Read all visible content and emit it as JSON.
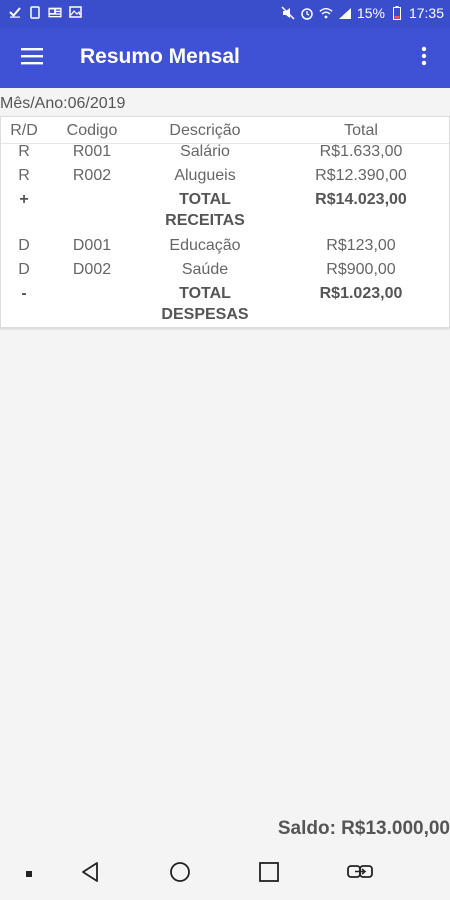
{
  "status_bar": {
    "icons_left": [
      "check-icon",
      "sim-icon",
      "news-icon",
      "image-icon"
    ],
    "icons_right": [
      "mute-icon",
      "alarm-icon",
      "wifi-icon",
      "signal-icon",
      "battery-icon"
    ],
    "battery": "15%",
    "time": "17:35",
    "color": "#3a4ecc"
  },
  "app_bar": {
    "title": "Resumo Mensal",
    "menu_icon": "hamburger-menu-icon",
    "overflow_icon": "more-vertical-icon",
    "color": "#3f51d4"
  },
  "period": "Mês/Ano:06/2019",
  "table": {
    "headers": {
      "rd": "R/D",
      "code": "Codigo",
      "description": "Descrição",
      "total": "Total"
    },
    "rows": [
      {
        "rd": "R",
        "code": "R001",
        "description": "Salário",
        "total": "R$1.633,00"
      },
      {
        "rd": "R",
        "code": "R002",
        "description": "Alugueis",
        "total": "R$12.390,00"
      },
      {
        "rd": "+",
        "code": "",
        "description_l1": "TOTAL",
        "description_l2": "RECEITAS",
        "total": "R$14.023,00"
      },
      {
        "rd": "D",
        "code": "D001",
        "description": "Educação",
        "total": "R$123,00"
      },
      {
        "rd": "D",
        "code": "D002",
        "description": "Saúde",
        "total": "R$900,00"
      },
      {
        "rd": "-",
        "code": "",
        "description_l1": "TOTAL",
        "description_l2": "DESPESAS",
        "total": "R$1.023,00"
      }
    ]
  },
  "saldo": "Saldo: R$13.000,00",
  "nav_bar": {
    "buttons": [
      "dot-icon",
      "back-icon",
      "home-icon",
      "recents-icon",
      "switch-apps-icon"
    ]
  }
}
